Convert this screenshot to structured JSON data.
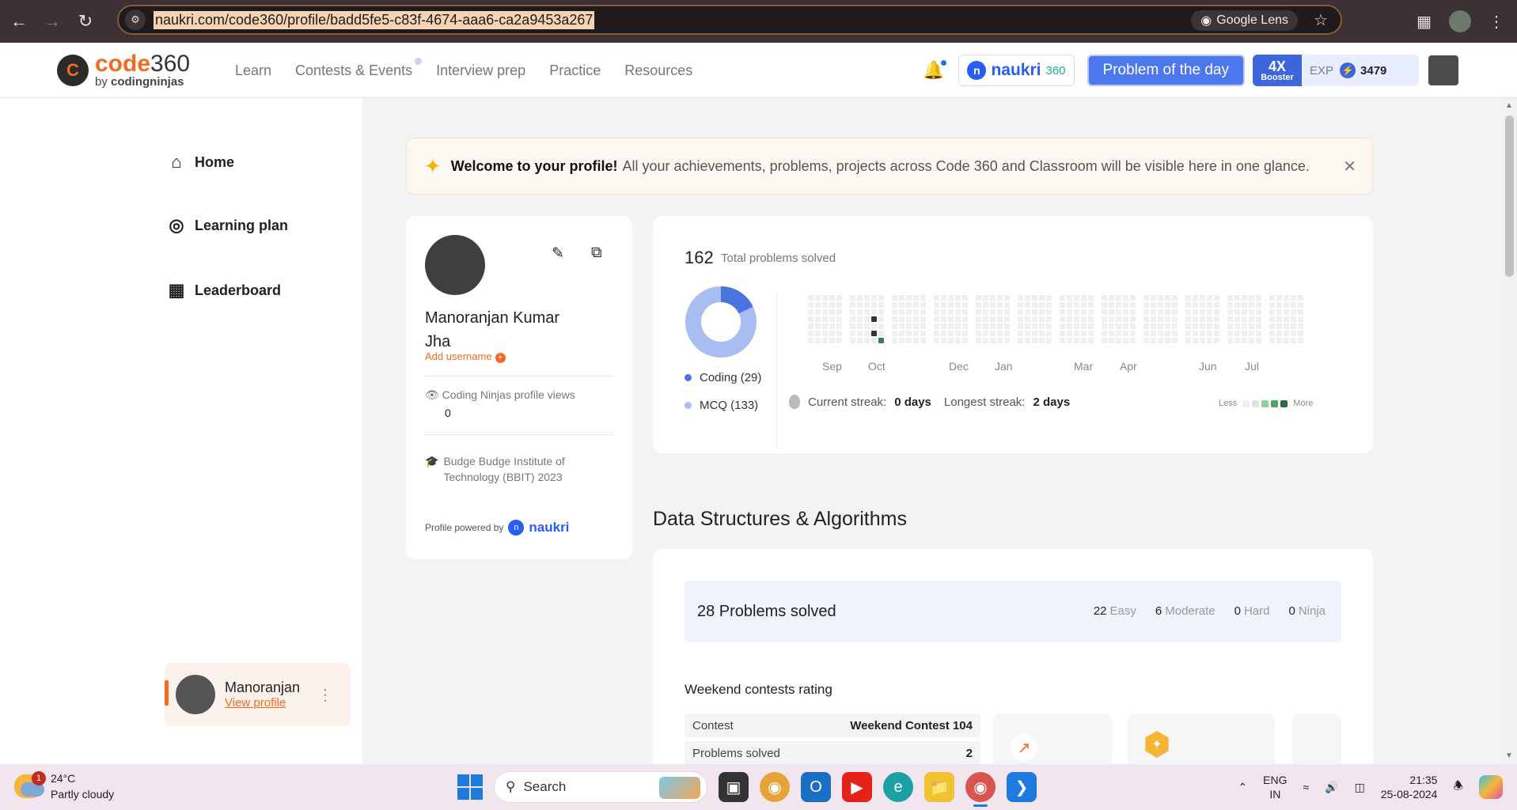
{
  "browser": {
    "url": "naukri.com/code360/profile/badd5fe5-c83f-4674-aaa6-ca2a9453a267",
    "lens_label": "Google Lens"
  },
  "header": {
    "logo_main": "code",
    "logo_num": "360",
    "logo_by": "by",
    "logo_sub": "codingninjas",
    "nav": [
      "Learn",
      "Contests & Events",
      "Interview prep",
      "Practice",
      "Resources"
    ],
    "naukri_label": "naukri",
    "naukri_num": "360",
    "potd_label": "Problem of the day",
    "booster_mult": "4X",
    "booster_label": "Booster",
    "exp_label": "EXP",
    "exp_value": "3479"
  },
  "sidebar": {
    "items": [
      {
        "label": "Home",
        "icon": "home-icon"
      },
      {
        "label": "Learning plan",
        "icon": "target-icon"
      },
      {
        "label": "Leaderboard",
        "icon": "leaderboard-icon"
      }
    ],
    "user_name": "Manoranjan",
    "user_link": "View profile"
  },
  "welcome": {
    "bold": "Welcome to your profile!",
    "text": "All your achievements, problems, projects across Code 360 and Classroom will be visible here in one glance."
  },
  "profile": {
    "name": "Manoranjan Kumar Jha",
    "add_username": "Add username",
    "views_label": "Coding Ninjas profile views",
    "views_value": "0",
    "college": "Budge Budge Institute of Technology (BBIT) 2023",
    "powered_by": "Profile powered by",
    "powered_brand": "naukri"
  },
  "stats": {
    "total_num": "162",
    "total_label": "Total problems solved",
    "coding_label": "Coding (29)",
    "mcq_label": "MCQ (133)",
    "coding_count": 29,
    "mcq_count": 133,
    "coding_color": "#4a74e0",
    "mcq_color": "#a9bdf1",
    "months": [
      "Sep",
      "Oct",
      "Dec",
      "Jan",
      "Mar",
      "Apr",
      "Jun",
      "Jul"
    ],
    "current_streak_label": "Current streak:",
    "current_streak_value": "0 days",
    "longest_streak_label": "Longest streak:",
    "longest_streak_value": "2 days",
    "less_label": "Less",
    "more_label": "More"
  },
  "dsa": {
    "section_title": "Data Structures & Algorithms",
    "solved_title": "28 Problems solved",
    "difficulty": [
      {
        "count": "22",
        "label": "Easy"
      },
      {
        "count": "6",
        "label": "Moderate"
      },
      {
        "count": "0",
        "label": "Hard"
      },
      {
        "count": "0",
        "label": "Ninja"
      }
    ],
    "weekend_title": "Weekend contests rating",
    "rows": [
      {
        "label": "Contest",
        "value": "Weekend Contest 104"
      },
      {
        "label": "Problems solved",
        "value": "2"
      }
    ]
  },
  "taskbar": {
    "weather_badge": "1",
    "temp": "24°C",
    "condition": "Partly cloudy",
    "search_label": "Search",
    "lang_top": "ENG",
    "lang_bottom": "IN",
    "time": "21:35",
    "date": "25-08-2024"
  }
}
